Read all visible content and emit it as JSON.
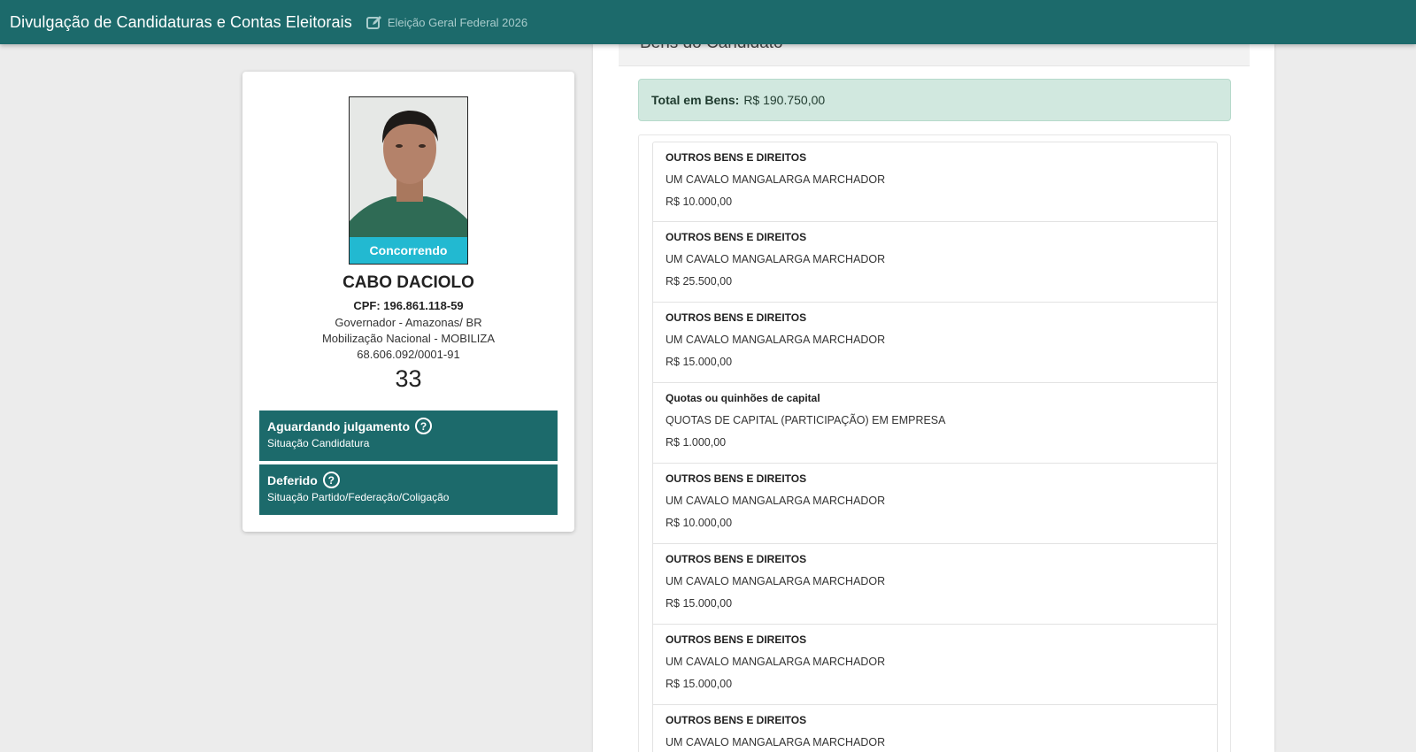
{
  "header": {
    "title": "Divulgação de Candidaturas e Contas Eleitorais",
    "election": "Eleição Geral Federal 2026",
    "edit_icon": "edit-icon"
  },
  "candidate": {
    "photo_status": "Concorrendo",
    "name": "CABO DACIOLO",
    "cpf": "CPF: 196.861.118-59",
    "office": "Governador - Amazonas/ BR",
    "party": "Mobilização Nacional - MOBILIZA",
    "cnpj": "68.606.092/0001-91",
    "number": "33",
    "status_candidatura": {
      "title": "Aguardando julgamento",
      "subtitle": "Situação Candidatura",
      "icon": "question-circle-icon"
    },
    "status_partido": {
      "title": "Deferido",
      "subtitle": "Situação Partido/Federação/Coligação",
      "icon": "question-circle-icon"
    }
  },
  "bens": {
    "section_title": "Bens do Candidato",
    "total_label": "Total em Bens:",
    "total_value": "R$ 190.750,00",
    "items": [
      {
        "type": "OUTROS BENS E DIREITOS",
        "desc": "UM CAVALO MANGALARGA MARCHADOR",
        "value": "R$ 10.000,00"
      },
      {
        "type": "OUTROS BENS E DIREITOS",
        "desc": "UM CAVALO MANGALARGA MARCHADOR",
        "value": "R$ 25.500,00"
      },
      {
        "type": "OUTROS BENS E DIREITOS",
        "desc": "UM CAVALO MANGALARGA MARCHADOR",
        "value": "R$ 15.000,00"
      },
      {
        "type": "Quotas ou quinhões de capital",
        "desc": "QUOTAS DE CAPITAL (PARTICIPAÇÃO) EM EMPRESA",
        "value": "R$ 1.000,00"
      },
      {
        "type": "OUTROS BENS E DIREITOS",
        "desc": "UM CAVALO MANGALARGA MARCHADOR",
        "value": "R$ 10.000,00"
      },
      {
        "type": "OUTROS BENS E DIREITOS",
        "desc": "UM CAVALO MANGALARGA MARCHADOR",
        "value": "R$ 15.000,00"
      },
      {
        "type": "OUTROS BENS E DIREITOS",
        "desc": "UM CAVALO MANGALARGA MARCHADOR",
        "value": "R$ 15.000,00"
      },
      {
        "type": "OUTROS BENS E DIREITOS",
        "desc": "UM CAVALO MANGALARGA MARCHADOR",
        "value": ""
      }
    ]
  }
}
